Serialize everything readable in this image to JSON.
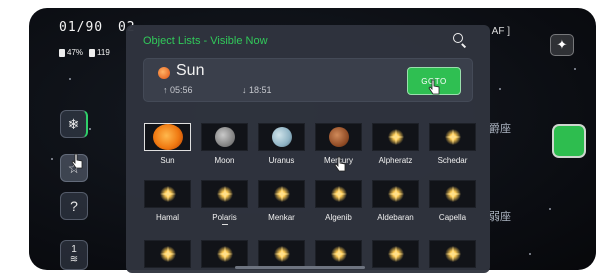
{
  "status": {
    "time": "01/90",
    "partial": "02",
    "battery": "47%",
    "storage": "119"
  },
  "right": {
    "top_text": "AF ]",
    "cn_label_1": "爵座",
    "cn_label_2": "弱座"
  },
  "left_buttons": {
    "layers_badge": "1"
  },
  "panel": {
    "title": "Object Lists - Visible Now",
    "selected": {
      "name": "Sun",
      "rise": "↑ 05:56",
      "set": "↓ 18:51",
      "goto_label": "GOTO"
    },
    "rows": [
      [
        {
          "label": "Sun",
          "icon": "sun-planet"
        },
        {
          "label": "Moon",
          "icon": "moon-planet"
        },
        {
          "label": "Uranus",
          "icon": "uranus-planet"
        },
        {
          "label": "Mercury",
          "icon": "mercury-planet"
        },
        {
          "label": "Alpheratz",
          "icon": "star-glow"
        },
        {
          "label": "Schedar",
          "icon": "star-glow"
        }
      ],
      [
        {
          "label": "Hamal",
          "icon": "star-glow"
        },
        {
          "label": "Polaris",
          "icon": "star-glow"
        },
        {
          "label": "Menkar",
          "icon": "star-glow"
        },
        {
          "label": "Algenib",
          "icon": "star-glow"
        },
        {
          "label": "Aldebaran",
          "icon": "star-glow"
        },
        {
          "label": "Capella",
          "icon": "star-glow"
        }
      ],
      [
        {
          "label": "",
          "icon": "star-glow"
        },
        {
          "label": "",
          "icon": "star-glow"
        },
        {
          "label": "",
          "icon": "star-glow"
        },
        {
          "label": "",
          "icon": "star-glow"
        },
        {
          "label": "",
          "icon": "star-glow"
        },
        {
          "label": "",
          "icon": "star-glow"
        }
      ]
    ]
  },
  "colors": {
    "accent": "#2fbf52",
    "panel_bg": "#30343e",
    "title_green": "#31c95a"
  }
}
